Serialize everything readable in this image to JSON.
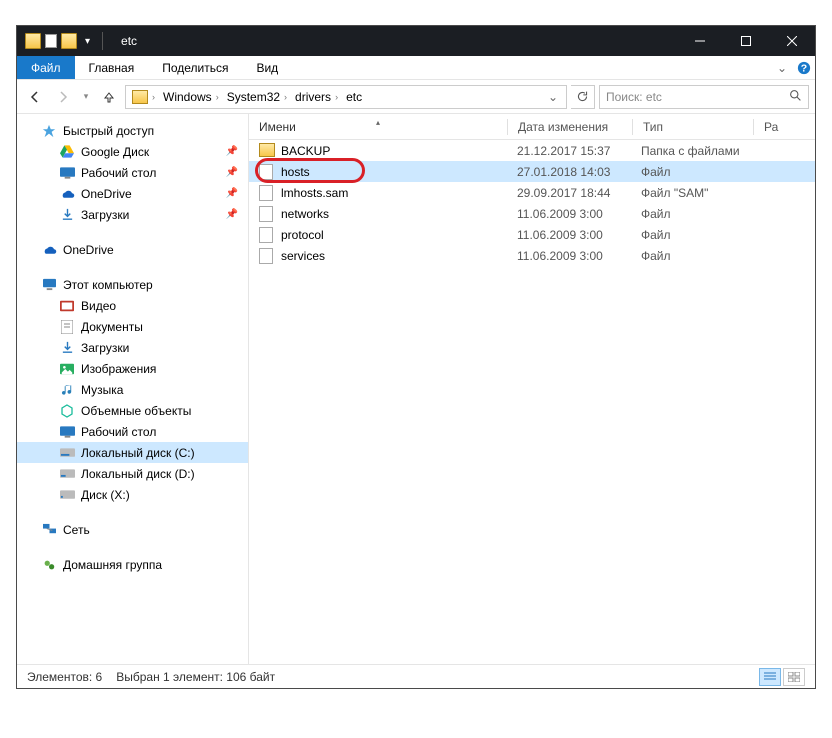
{
  "window": {
    "title": "etc"
  },
  "ribbon": {
    "file": "Файл",
    "home": "Главная",
    "share": "Поделиться",
    "view": "Вид"
  },
  "breadcrumb": [
    "Windows",
    "System32",
    "drivers",
    "etc"
  ],
  "search": {
    "placeholder": "Поиск: etc"
  },
  "columns": {
    "name": "Имени",
    "date": "Дата изменения",
    "type": "Тип",
    "size": "Ра"
  },
  "sidebar": {
    "quick": {
      "label": "Быстрый доступ",
      "items": [
        {
          "id": "gdrive",
          "label": "Google Диск",
          "pinned": true
        },
        {
          "id": "desktop",
          "label": "Рабочий стол",
          "pinned": true
        },
        {
          "id": "onedrive1",
          "label": "OneDrive",
          "pinned": true
        },
        {
          "id": "downloads1",
          "label": "Загрузки",
          "pinned": true
        }
      ]
    },
    "onedrive": {
      "label": "OneDrive"
    },
    "thispc": {
      "label": "Этот компьютер",
      "items": [
        {
          "id": "videos",
          "label": "Видео"
        },
        {
          "id": "documents",
          "label": "Документы"
        },
        {
          "id": "downloads2",
          "label": "Загрузки"
        },
        {
          "id": "pictures",
          "label": "Изображения"
        },
        {
          "id": "music",
          "label": "Музыка"
        },
        {
          "id": "3dobjects",
          "label": "Объемные объекты"
        },
        {
          "id": "desktop2",
          "label": "Рабочий стол"
        },
        {
          "id": "diskc",
          "label": "Локальный диск (C:)",
          "selected": true
        },
        {
          "id": "diskd",
          "label": "Локальный диск (D:)"
        },
        {
          "id": "diskx",
          "label": "Диск (X:)"
        }
      ]
    },
    "network": {
      "label": "Сеть"
    },
    "homegroup": {
      "label": "Домашняя группа"
    }
  },
  "files": [
    {
      "name": "BACKUP",
      "date": "21.12.2017 15:37",
      "type": "Папка с файлами",
      "folder": true
    },
    {
      "name": "hosts",
      "date": "27.01.2018 14:03",
      "type": "Файл",
      "selected": true,
      "highlight": true
    },
    {
      "name": "lmhosts.sam",
      "date": "29.09.2017 18:44",
      "type": "Файл \"SAM\""
    },
    {
      "name": "networks",
      "date": "11.06.2009 3:00",
      "type": "Файл"
    },
    {
      "name": "protocol",
      "date": "11.06.2009 3:00",
      "type": "Файл"
    },
    {
      "name": "services",
      "date": "11.06.2009 3:00",
      "type": "Файл"
    }
  ],
  "status": {
    "count": "Элементов: 6",
    "selection": "Выбран 1 элемент: 106 байт"
  }
}
